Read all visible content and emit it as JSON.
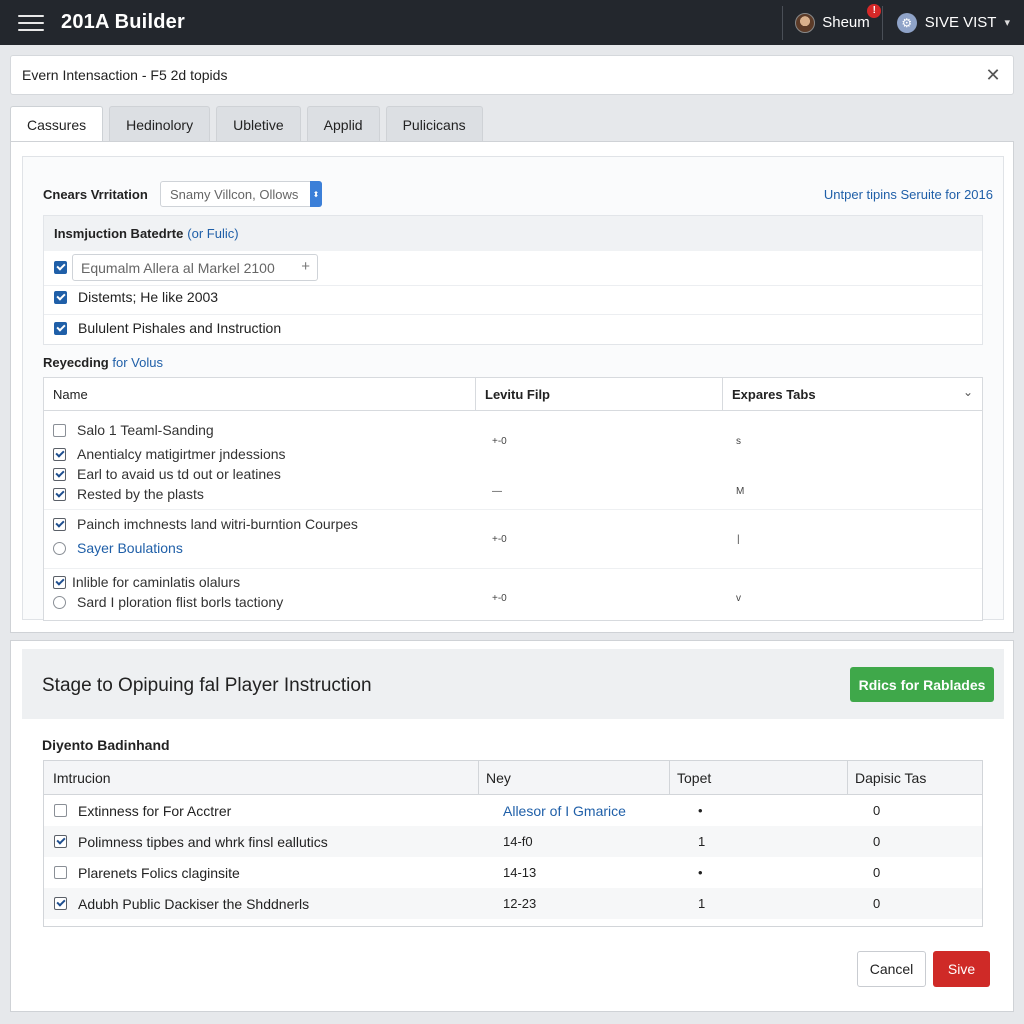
{
  "app": {
    "title": "201A Builder",
    "user_name": "Sheum",
    "notification_count": "!",
    "site_label": "SIVE VIST"
  },
  "dialog": {
    "title": "Evern Intensaction - F5 2d topids"
  },
  "tabs": [
    {
      "label": "Cassures",
      "active": true
    },
    {
      "label": "Hedinolory",
      "active": false
    },
    {
      "label": "Ubletive",
      "active": false
    },
    {
      "label": "Applid",
      "active": false
    },
    {
      "label": "Pulicicans",
      "active": false
    }
  ],
  "filter": {
    "label": "Cnears Vrritation",
    "placeholder": "Snamy Villcon, Ollows",
    "link": "Untper tipins Seruite for 2016"
  },
  "instructions": {
    "heading": "Insmjuction Batedrte",
    "heading_link": "(or Fulic)",
    "items": [
      {
        "text": "Equmalm Allera al Markel 2100",
        "checked": true,
        "as_input": true
      },
      {
        "text": "Distemts; He like 2003",
        "checked": true
      },
      {
        "text": "Bululent Pishales and Instruction",
        "checked": true
      }
    ]
  },
  "section": {
    "title": "Reyecding",
    "title_link": "for Volus"
  },
  "table1": {
    "headers": [
      "Name",
      "Levitu Filp",
      "Expares Tabs"
    ],
    "rows": [
      {
        "text": "Salo 1 Teaml-Sanding",
        "control": "checkbox",
        "checked": false
      },
      {
        "text": "Anentialcy matigirtmer jndessions",
        "control": "checkbox",
        "checked": true
      },
      {
        "text": "Earl to avaid us td out or leatines",
        "control": "checkbox",
        "checked": true
      },
      {
        "text": "Rested by the plasts",
        "control": "checkbox",
        "checked": true
      },
      {
        "text": "Painch imchnests land witri-burntion Courpes",
        "control": "checkbox",
        "checked": true
      },
      {
        "text": "Sayer Boulations",
        "control": "radio",
        "checked": false,
        "link": true
      },
      {
        "text": "Inlible for caminlatis olalurs",
        "control": "checkbox",
        "checked": true
      },
      {
        "text": "Sard I ploration flist borls tactiony",
        "control": "radio",
        "checked": false
      }
    ],
    "col2_values": [
      "+-0",
      "—",
      "+-0",
      "+-0"
    ],
    "col3_values": [
      "s",
      "M",
      "|",
      "v"
    ]
  },
  "panel2": {
    "title": "Stage to Opipuing fal Player Instruction",
    "action_button": "Rdics for Rablades",
    "subtitle": "Diyento Badinhand",
    "table": {
      "headers": [
        "Imtrucion",
        "Ney",
        "Topet",
        "Dapisic Tas"
      ],
      "rows": [
        {
          "checked": false,
          "name": "Extinness for For Acctrer",
          "ney": "Allesor of I Gmarice",
          "ney_link": true,
          "topet": "•",
          "tas": "0"
        },
        {
          "checked": true,
          "name": "Polimness tipbes and whrk finsl eallutics",
          "ney": "14-f0",
          "ney_link": false,
          "topet": "1",
          "tas": "0"
        },
        {
          "checked": false,
          "name": "Plarenets Folics claginsite",
          "ney": "14-13",
          "ney_link": false,
          "topet": "•",
          "tas": "0"
        },
        {
          "checked": true,
          "name": "Adubh Public Dackiser the Shddnerls",
          "ney": "12-23",
          "ney_link": false,
          "topet": "1",
          "tas": "0"
        }
      ]
    },
    "cancel_label": "Cancel",
    "save_label": "Sive"
  },
  "colors": {
    "topbar": "#23272d",
    "accent": "#1f5fa8",
    "green": "#3fa84a",
    "red": "#cf2a27"
  },
  "icons": [
    "menu-icon",
    "close-icon",
    "chevron-down-icon",
    "globe-icon",
    "plus-icon"
  ]
}
